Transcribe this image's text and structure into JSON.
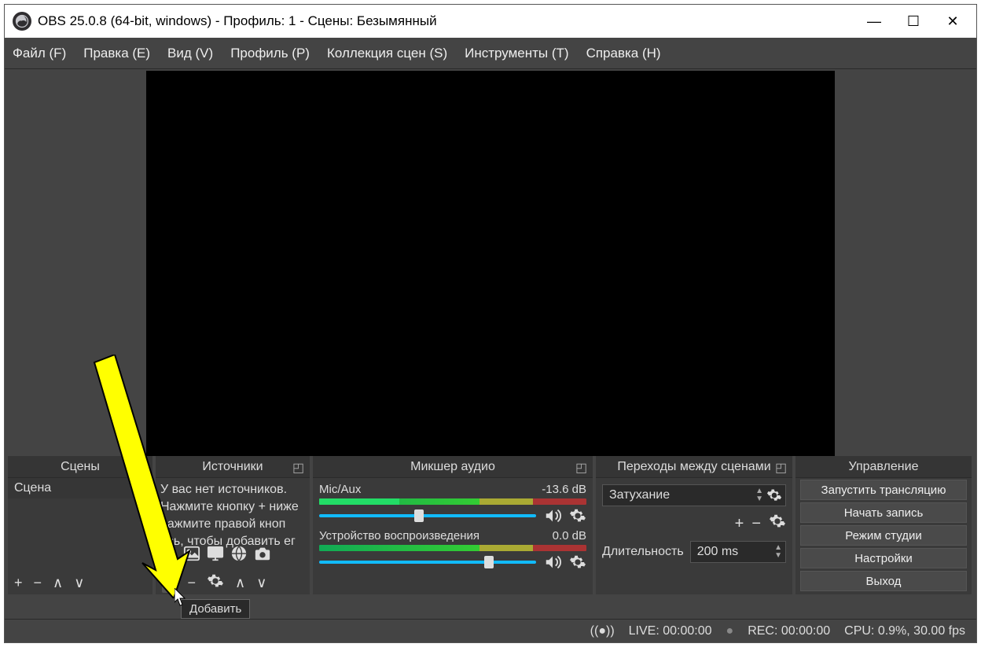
{
  "title": "OBS 25.0.8 (64-bit, windows) - Профиль: 1 - Сцены: Безымянный",
  "menu": {
    "file": "Файл (F)",
    "edit": "Правка (E)",
    "view": "Вид (V)",
    "profile": "Профиль (P)",
    "scene_collection": "Коллекция сцен (S)",
    "tools": "Инструменты (T)",
    "help": "Справка (H)"
  },
  "docks": {
    "scenes": {
      "title": "Сцены",
      "items": [
        "Сцена"
      ]
    },
    "sources": {
      "title": "Источники",
      "hint_lines": [
        "У вас нет источников.",
        "Нажмите кнопку + ниже",
        "нажмите правой кноп",
        "есь, чтобы добавить ег"
      ]
    },
    "mixer": {
      "title": "Микшер аудио",
      "channels": [
        {
          "name": "Mic/Aux",
          "db": "-13.6 dB",
          "thumb_pct": 44
        },
        {
          "name": "Устройство воспроизведения",
          "db": "0.0 dB",
          "thumb_pct": 76
        }
      ]
    },
    "transitions": {
      "title": "Переходы между сценами",
      "selected": "Затухание",
      "duration_label": "Длительность",
      "duration_value": "200 ms"
    },
    "controls": {
      "title": "Управление",
      "buttons": {
        "stream": "Запустить трансляцию",
        "record": "Начать запись",
        "studio": "Режим студии",
        "settings": "Настройки",
        "exit": "Выход"
      }
    }
  },
  "status": {
    "live": "LIVE: 00:00:00",
    "rec": "REC: 00:00:00",
    "cpu": "CPU: 0.9%, 30.00 fps"
  },
  "tooltip": "Добавить"
}
